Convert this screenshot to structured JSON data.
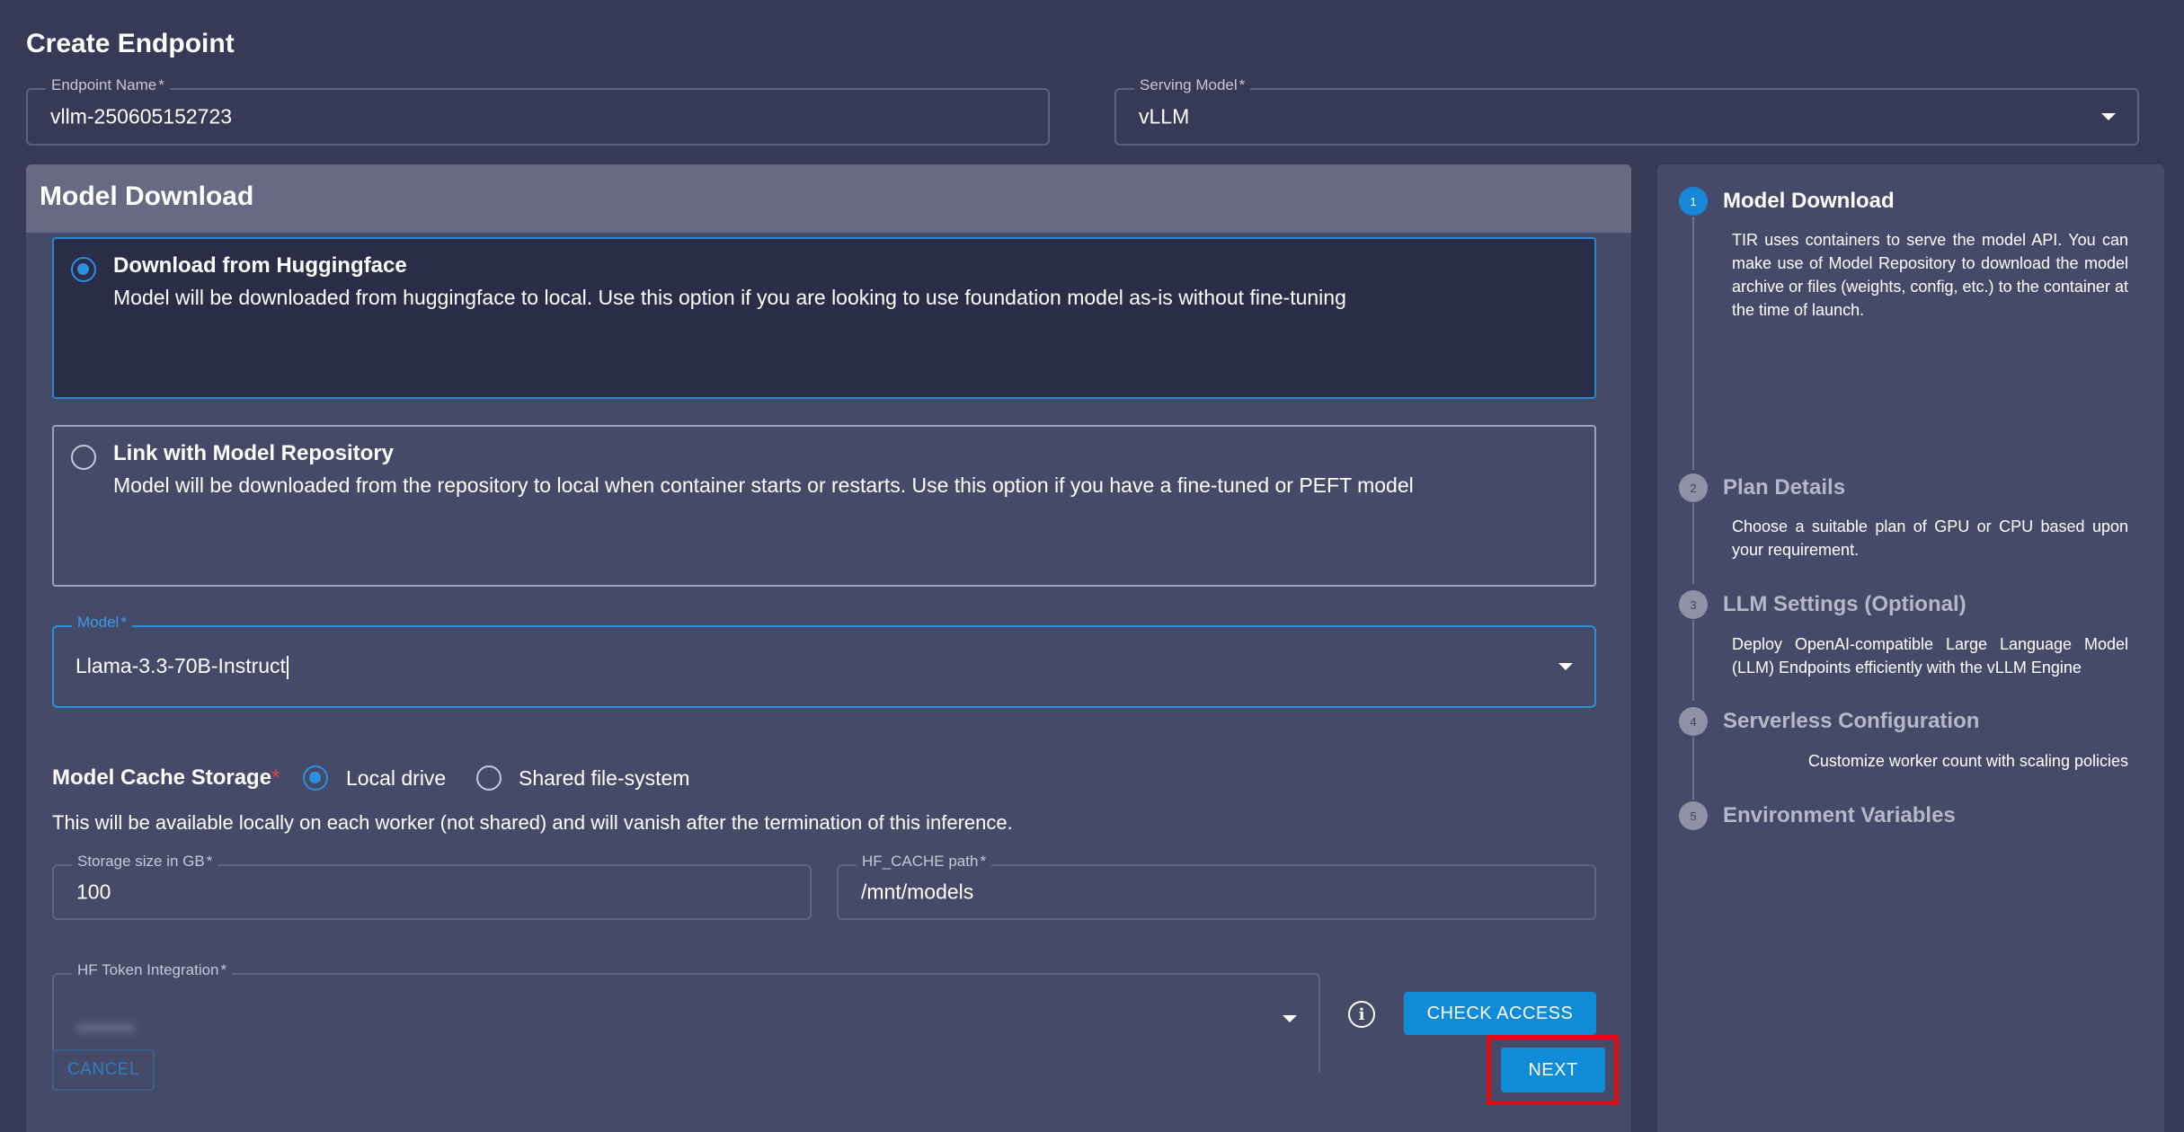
{
  "page": {
    "title": "Create Endpoint"
  },
  "endpoint_name": {
    "label": "Endpoint Name",
    "required_mark": "*",
    "value": "vllm-250605152723"
  },
  "serving_model": {
    "label": "Serving Model",
    "required_mark": "*",
    "value": "vLLM"
  },
  "model_download": {
    "title": "Model Download",
    "options": [
      {
        "title": "Download from Huggingface",
        "description": "Model will be downloaded from huggingface to local. Use this option if you are looking to use foundation model as-is without fine-tuning",
        "selected": true
      },
      {
        "title": "Link with Model Repository",
        "description": "Model will be downloaded from the repository to local when container starts or restarts. Use this option if you have a fine-tuned or PEFT model",
        "selected": false
      }
    ],
    "model_field": {
      "label": "Model",
      "required_mark": "*",
      "value": "Llama-3.3-70B-Instruct"
    },
    "cache_storage": {
      "label": "Model Cache Storage",
      "required_mark": "*",
      "options": [
        {
          "label": "Local drive",
          "selected": true
        },
        {
          "label": "Shared file-system",
          "selected": false
        }
      ],
      "helper": "This will be available locally on each worker (not shared) and will vanish after the termination of this inference."
    },
    "storage_size": {
      "label": "Storage size in GB",
      "required_mark": "*",
      "value": "100"
    },
    "hf_cache_path": {
      "label": "HF_CACHE path",
      "required_mark": "*",
      "value": "/mnt/models"
    },
    "hf_token": {
      "label": "HF Token Integration",
      "required_mark": "*",
      "value": "••••••••"
    },
    "info_icon_glyph": "i",
    "check_access_label": "CHECK ACCESS",
    "cancel_label": "CANCEL",
    "next_label": "NEXT"
  },
  "stepper": {
    "steps": [
      {
        "number": "1",
        "title": "Model Download",
        "active": true,
        "description": "TIR uses containers to serve the model API. You can make use of Model Repository to download the model archive or files (weights, config, etc.) to the container at the time of launch."
      },
      {
        "number": "2",
        "title": "Plan Details",
        "active": false,
        "description": "Choose a suitable plan of GPU or CPU based upon your requirement."
      },
      {
        "number": "3",
        "title": "LLM Settings (Optional)",
        "active": false,
        "description": "Deploy OpenAI-compatible Large Language Model (LLM) Endpoints efficiently with the vLLM Engine"
      },
      {
        "number": "4",
        "title": "Serverless Configuration",
        "active": false,
        "description": "Customize worker count with scaling policies"
      },
      {
        "number": "5",
        "title": "Environment Variables",
        "active": false,
        "description": ""
      }
    ]
  },
  "colors": {
    "background": "#363a56",
    "panel": "#464a69",
    "accent": "#0f8bd8",
    "highlight": "#e00c14"
  }
}
